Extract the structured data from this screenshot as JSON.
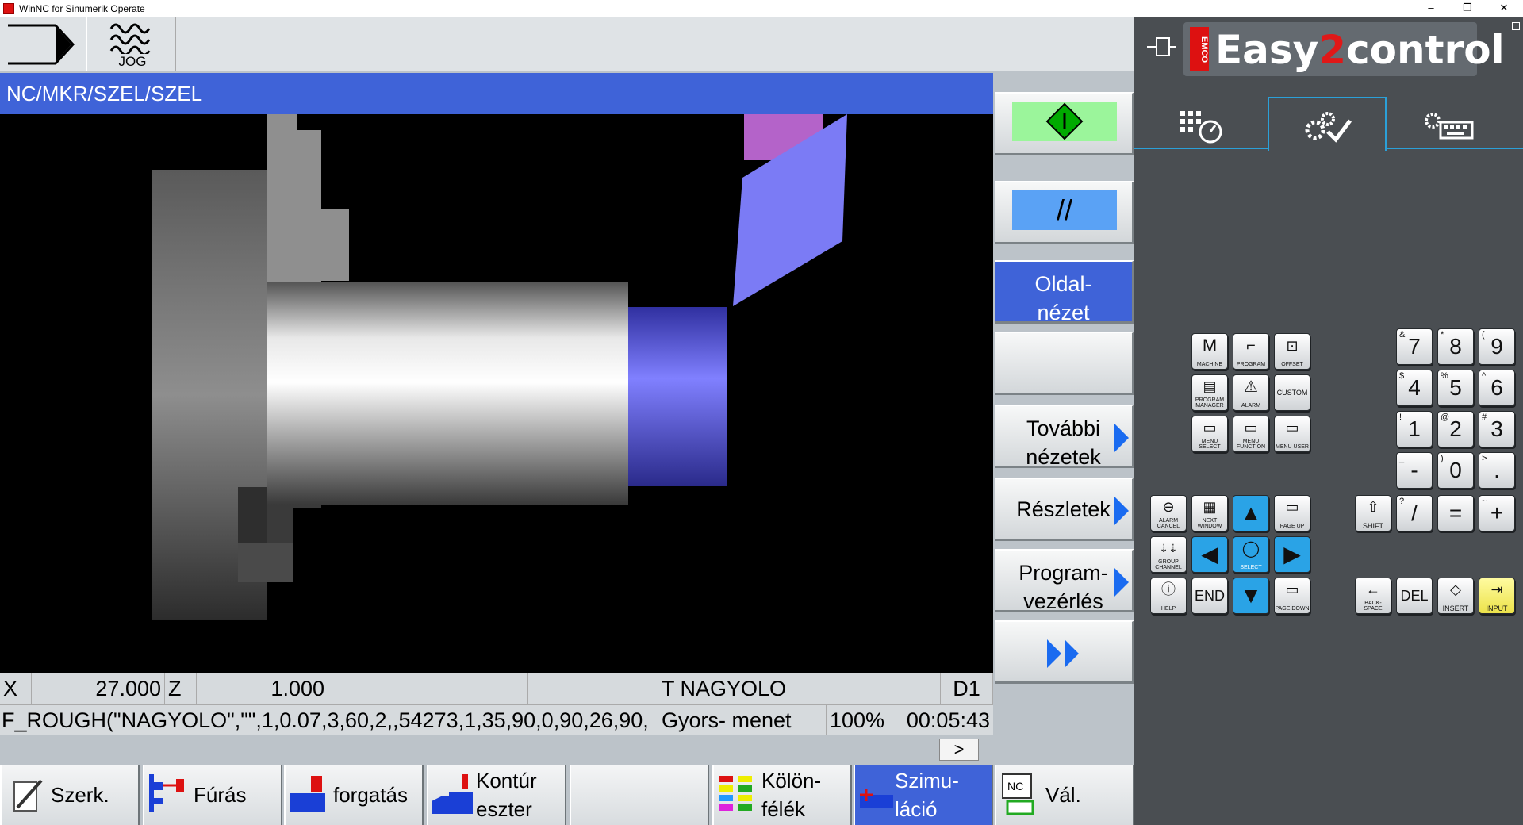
{
  "window": {
    "title": "WinNC for Sinumerik Operate",
    "minimize": "–",
    "restore": "❐",
    "close": "✕"
  },
  "topbar": {
    "jog_label": "JOG"
  },
  "path": "NC/MKR/SZEL/SZEL",
  "status": {
    "x_label": "X",
    "x_value": "27.000",
    "z_label": "Z",
    "z_value": "1.000",
    "tool": "T NAGYOLO",
    "d": "D1",
    "program_line": "F_ROUGH(\"NAGYOLO\",\"\",1,0.07,3,60,2,,54273,1,35,90,0,90,26,90,",
    "feed_mode": "Gyors- menet",
    "override": "100%",
    "time": "00:05:43",
    "more": ">"
  },
  "vertical_softkeys": [
    {
      "label": ""
    },
    {
      "label": "//"
    },
    {
      "label": "Oldal-\nnézet"
    },
    {
      "label": ""
    },
    {
      "label": "További\nnézetek"
    },
    {
      "label": "Részletek"
    },
    {
      "label": "Program-\nvezérlés"
    },
    {
      "label": ""
    }
  ],
  "bottom_softkeys": [
    {
      "label": "Szerk."
    },
    {
      "label": "Fúrás"
    },
    {
      "label": "forgatás"
    },
    {
      "label": "Kontúr\neszter"
    },
    {
      "label": ""
    },
    {
      "label": "Kölön-\nfélék"
    },
    {
      "label": "Szimu-\nláció"
    },
    {
      "label": "Vál."
    }
  ],
  "panel": {
    "logo_prefix": "Easy",
    "logo_two": "2",
    "logo_suffix": "control",
    "brand": "EMCO",
    "keys": {
      "machine": "MACHINE",
      "program": "PROGRAM",
      "offset": "OFFSET",
      "program_manager": "PROGRAM MANAGER",
      "alarm": "ALARM",
      "custom": "CUSTOM",
      "menu_select": "MENU SELECT",
      "menu_function": "MENU FUNCTION",
      "menu_user": "MENU USER",
      "alarm_cancel": "ALARM CANCEL",
      "next_window": "NEXT WINDOW",
      "page_up": "PAGE UP",
      "group_channel": "GROUP CHANNEL",
      "select": "SELECT",
      "help": "HELP",
      "end": "END",
      "page_down": "PAGE DOWN",
      "shift": "SHIFT",
      "backspace": "BACK-SPACE",
      "del": "DEL",
      "insert": "INSERT",
      "input": "INPUT"
    },
    "numpad": [
      {
        "big": "7",
        "sup": "&"
      },
      {
        "big": "8",
        "sup": "*"
      },
      {
        "big": "9",
        "sup": "("
      },
      {
        "big": "4",
        "sup": "$"
      },
      {
        "big": "5",
        "sup": "%"
      },
      {
        "big": "6",
        "sup": "^"
      },
      {
        "big": "1",
        "sup": "!"
      },
      {
        "big": "2",
        "sup": "@"
      },
      {
        "big": "3",
        "sup": "#"
      },
      {
        "big": "-",
        "sup": "_"
      },
      {
        "big": "0",
        "sup": ")"
      },
      {
        "big": ".",
        "sup": ">"
      },
      {
        "big": "/",
        "sup": "?"
      },
      {
        "big": "=",
        "sup": ""
      },
      {
        "big": "+",
        "sup": "~"
      }
    ]
  },
  "colors": {
    "accent_blue": "#3f63d8",
    "cycle_start_green": "#9bf59b",
    "tool_blue": "#7b7bf5",
    "panel_bg": "#4a4e52"
  }
}
